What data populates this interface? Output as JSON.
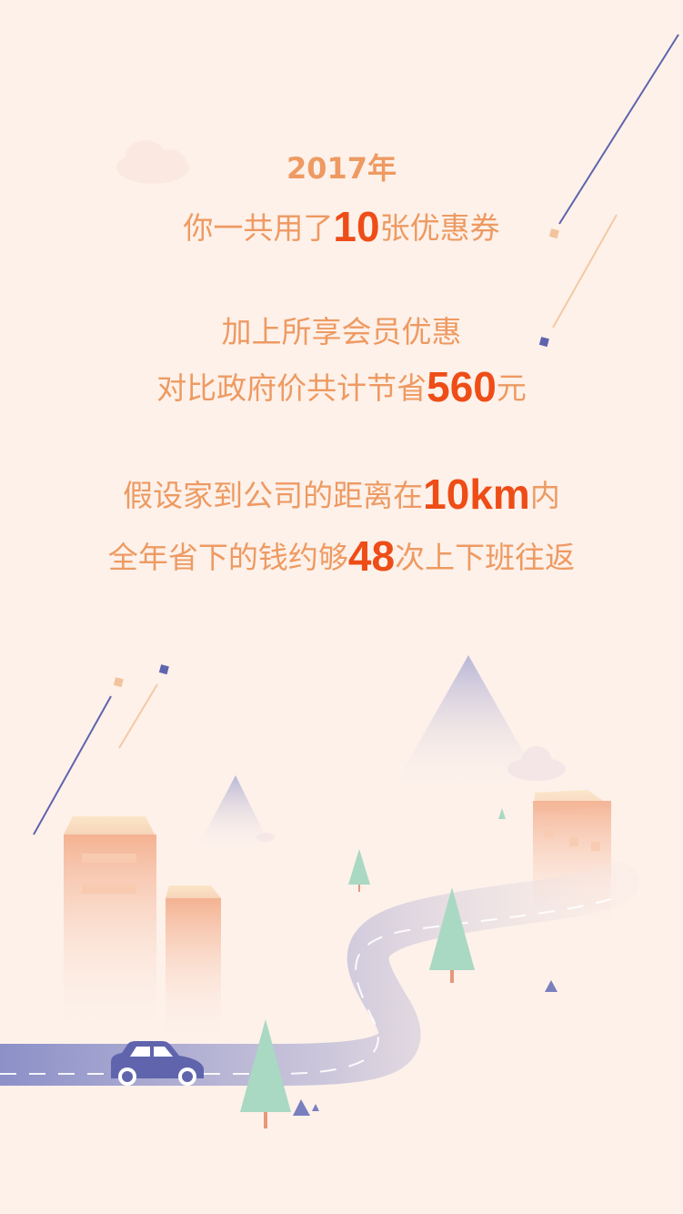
{
  "summary": {
    "year": "2017年",
    "coupon_prefix": "你一共用了",
    "coupon_count": "10",
    "coupon_suffix": "张优惠券",
    "member_line": "加上所享会员优惠",
    "saving_prefix": "对比政府价共计节省",
    "saving_amount": "560",
    "saving_suffix": "元",
    "distance_prefix": "假设家到公司的距离在",
    "distance_value": "10km",
    "distance_suffix": "内",
    "trips_prefix": "全年省下的钱约够",
    "trips_count": "48",
    "trips_suffix": "次上下班往返"
  },
  "colors": {
    "background": "#fdf1ea",
    "text": "#ee9a62",
    "highlight": "#ee4d17",
    "accent_purple": "#5f64ad",
    "tree_green": "#a9d8c3",
    "building": "#f5b695",
    "road": "#8b8fc6"
  },
  "icons": {
    "cloud": "cloud-icon",
    "car": "car-icon",
    "tree": "tree-icon",
    "mountain": "mountain-icon"
  }
}
